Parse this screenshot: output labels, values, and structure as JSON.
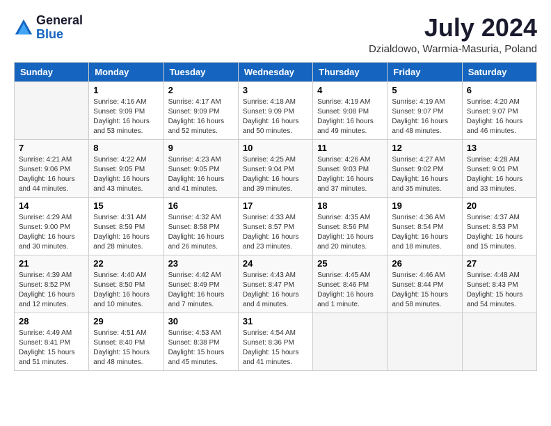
{
  "header": {
    "logo": {
      "general": "General",
      "blue": "Blue"
    },
    "title": "July 2024",
    "location": "Dzialdowo, Warmia-Masuria, Poland"
  },
  "calendar": {
    "days_of_week": [
      "Sunday",
      "Monday",
      "Tuesday",
      "Wednesday",
      "Thursday",
      "Friday",
      "Saturday"
    ],
    "weeks": [
      [
        {
          "day": "",
          "sunrise": "",
          "sunset": "",
          "daylight": ""
        },
        {
          "day": "1",
          "sunrise": "Sunrise: 4:16 AM",
          "sunset": "Sunset: 9:09 PM",
          "daylight": "Daylight: 16 hours and 53 minutes."
        },
        {
          "day": "2",
          "sunrise": "Sunrise: 4:17 AM",
          "sunset": "Sunset: 9:09 PM",
          "daylight": "Daylight: 16 hours and 52 minutes."
        },
        {
          "day": "3",
          "sunrise": "Sunrise: 4:18 AM",
          "sunset": "Sunset: 9:09 PM",
          "daylight": "Daylight: 16 hours and 50 minutes."
        },
        {
          "day": "4",
          "sunrise": "Sunrise: 4:19 AM",
          "sunset": "Sunset: 9:08 PM",
          "daylight": "Daylight: 16 hours and 49 minutes."
        },
        {
          "day": "5",
          "sunrise": "Sunrise: 4:19 AM",
          "sunset": "Sunset: 9:07 PM",
          "daylight": "Daylight: 16 hours and 48 minutes."
        },
        {
          "day": "6",
          "sunrise": "Sunrise: 4:20 AM",
          "sunset": "Sunset: 9:07 PM",
          "daylight": "Daylight: 16 hours and 46 minutes."
        }
      ],
      [
        {
          "day": "7",
          "sunrise": "Sunrise: 4:21 AM",
          "sunset": "Sunset: 9:06 PM",
          "daylight": "Daylight: 16 hours and 44 minutes."
        },
        {
          "day": "8",
          "sunrise": "Sunrise: 4:22 AM",
          "sunset": "Sunset: 9:05 PM",
          "daylight": "Daylight: 16 hours and 43 minutes."
        },
        {
          "day": "9",
          "sunrise": "Sunrise: 4:23 AM",
          "sunset": "Sunset: 9:05 PM",
          "daylight": "Daylight: 16 hours and 41 minutes."
        },
        {
          "day": "10",
          "sunrise": "Sunrise: 4:25 AM",
          "sunset": "Sunset: 9:04 PM",
          "daylight": "Daylight: 16 hours and 39 minutes."
        },
        {
          "day": "11",
          "sunrise": "Sunrise: 4:26 AM",
          "sunset": "Sunset: 9:03 PM",
          "daylight": "Daylight: 16 hours and 37 minutes."
        },
        {
          "day": "12",
          "sunrise": "Sunrise: 4:27 AM",
          "sunset": "Sunset: 9:02 PM",
          "daylight": "Daylight: 16 hours and 35 minutes."
        },
        {
          "day": "13",
          "sunrise": "Sunrise: 4:28 AM",
          "sunset": "Sunset: 9:01 PM",
          "daylight": "Daylight: 16 hours and 33 minutes."
        }
      ],
      [
        {
          "day": "14",
          "sunrise": "Sunrise: 4:29 AM",
          "sunset": "Sunset: 9:00 PM",
          "daylight": "Daylight: 16 hours and 30 minutes."
        },
        {
          "day": "15",
          "sunrise": "Sunrise: 4:31 AM",
          "sunset": "Sunset: 8:59 PM",
          "daylight": "Daylight: 16 hours and 28 minutes."
        },
        {
          "day": "16",
          "sunrise": "Sunrise: 4:32 AM",
          "sunset": "Sunset: 8:58 PM",
          "daylight": "Daylight: 16 hours and 26 minutes."
        },
        {
          "day": "17",
          "sunrise": "Sunrise: 4:33 AM",
          "sunset": "Sunset: 8:57 PM",
          "daylight": "Daylight: 16 hours and 23 minutes."
        },
        {
          "day": "18",
          "sunrise": "Sunrise: 4:35 AM",
          "sunset": "Sunset: 8:56 PM",
          "daylight": "Daylight: 16 hours and 20 minutes."
        },
        {
          "day": "19",
          "sunrise": "Sunrise: 4:36 AM",
          "sunset": "Sunset: 8:54 PM",
          "daylight": "Daylight: 16 hours and 18 minutes."
        },
        {
          "day": "20",
          "sunrise": "Sunrise: 4:37 AM",
          "sunset": "Sunset: 8:53 PM",
          "daylight": "Daylight: 16 hours and 15 minutes."
        }
      ],
      [
        {
          "day": "21",
          "sunrise": "Sunrise: 4:39 AM",
          "sunset": "Sunset: 8:52 PM",
          "daylight": "Daylight: 16 hours and 12 minutes."
        },
        {
          "day": "22",
          "sunrise": "Sunrise: 4:40 AM",
          "sunset": "Sunset: 8:50 PM",
          "daylight": "Daylight: 16 hours and 10 minutes."
        },
        {
          "day": "23",
          "sunrise": "Sunrise: 4:42 AM",
          "sunset": "Sunset: 8:49 PM",
          "daylight": "Daylight: 16 hours and 7 minutes."
        },
        {
          "day": "24",
          "sunrise": "Sunrise: 4:43 AM",
          "sunset": "Sunset: 8:47 PM",
          "daylight": "Daylight: 16 hours and 4 minutes."
        },
        {
          "day": "25",
          "sunrise": "Sunrise: 4:45 AM",
          "sunset": "Sunset: 8:46 PM",
          "daylight": "Daylight: 16 hours and 1 minute."
        },
        {
          "day": "26",
          "sunrise": "Sunrise: 4:46 AM",
          "sunset": "Sunset: 8:44 PM",
          "daylight": "Daylight: 15 hours and 58 minutes."
        },
        {
          "day": "27",
          "sunrise": "Sunrise: 4:48 AM",
          "sunset": "Sunset: 8:43 PM",
          "daylight": "Daylight: 15 hours and 54 minutes."
        }
      ],
      [
        {
          "day": "28",
          "sunrise": "Sunrise: 4:49 AM",
          "sunset": "Sunset: 8:41 PM",
          "daylight": "Daylight: 15 hours and 51 minutes."
        },
        {
          "day": "29",
          "sunrise": "Sunrise: 4:51 AM",
          "sunset": "Sunset: 8:40 PM",
          "daylight": "Daylight: 15 hours and 48 minutes."
        },
        {
          "day": "30",
          "sunrise": "Sunrise: 4:53 AM",
          "sunset": "Sunset: 8:38 PM",
          "daylight": "Daylight: 15 hours and 45 minutes."
        },
        {
          "day": "31",
          "sunrise": "Sunrise: 4:54 AM",
          "sunset": "Sunset: 8:36 PM",
          "daylight": "Daylight: 15 hours and 41 minutes."
        },
        {
          "day": "",
          "sunrise": "",
          "sunset": "",
          "daylight": ""
        },
        {
          "day": "",
          "sunrise": "",
          "sunset": "",
          "daylight": ""
        },
        {
          "day": "",
          "sunrise": "",
          "sunset": "",
          "daylight": ""
        }
      ]
    ]
  }
}
